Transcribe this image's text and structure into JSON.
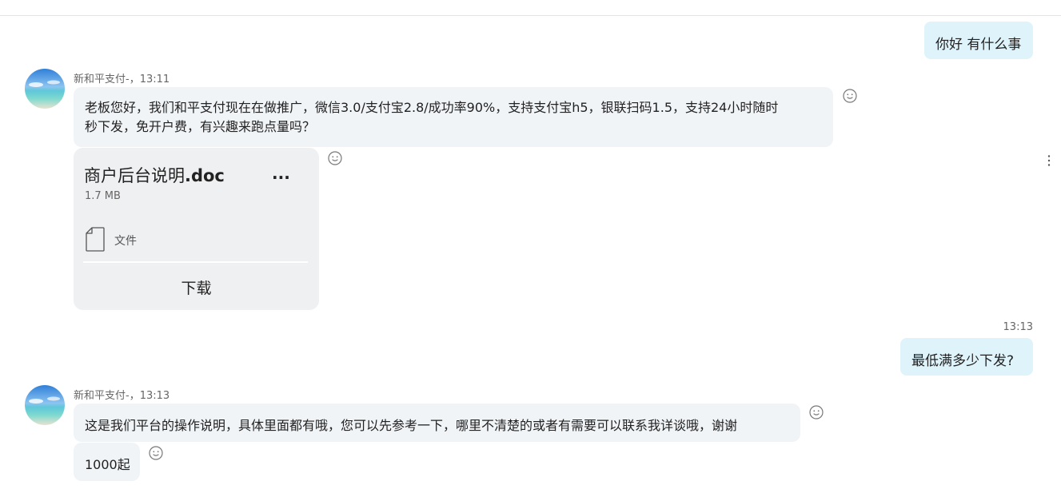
{
  "messages": {
    "out1": {
      "text": "你好 有什么事"
    },
    "in1": {
      "sender": "新和平支付-，13:11",
      "text_line1": "老板您好，我们和平支付现在在做推广，微信3.0/支付宝2.8/成功率90%，支持支付宝h5，银联扫码1.5，支持24小时随时",
      "text_line2": "秒下发，免开户费，有兴趣来跑点量吗？"
    },
    "file": {
      "name_prefix": "商户后台说明",
      "name_ext": ".doc",
      "more": "...",
      "size": "1.7 MB",
      "type_label": "文件",
      "download_label": "下载"
    },
    "out2": {
      "time": "13:13",
      "text": "最低满多少下发?"
    },
    "in2": {
      "sender": "新和平支付-，13:13",
      "text": "这是我们平台的操作说明，具体里面都有哦，您可以先参考一下，哪里不清楚的或者有需要可以联系我详谈哦，谢谢"
    },
    "in3": {
      "text": "1000起"
    }
  },
  "icons": {
    "react": "smiley-icon",
    "menu": "vertical-ellipsis-icon",
    "file": "document-icon"
  },
  "colors": {
    "outgoing_bubble": "#dff3fb",
    "incoming_bubble": "#f1f4f7",
    "file_card": "#eff0f2"
  }
}
